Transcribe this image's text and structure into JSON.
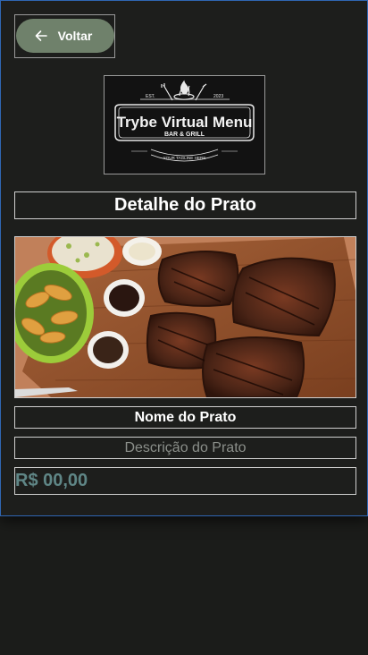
{
  "header": {
    "back_label": "Voltar"
  },
  "logo": {
    "brand": "Trybe Virtual Menu",
    "subtitle": "BAR & GRILL",
    "est": "EST.",
    "year": "2023",
    "tagline": "YOUR TAGLINE HERE"
  },
  "page": {
    "title": "Detalhe do Prato"
  },
  "dish": {
    "name": "Nome do Prato",
    "description": "Descrição do Prato",
    "price": "R$ 00,00"
  },
  "colors": {
    "background": "#1d1e1c",
    "button": "#6f816b",
    "price": "#5f8686",
    "panel_border": "#2f66b3"
  },
  "icons": {
    "back": "arrow-left-icon"
  }
}
